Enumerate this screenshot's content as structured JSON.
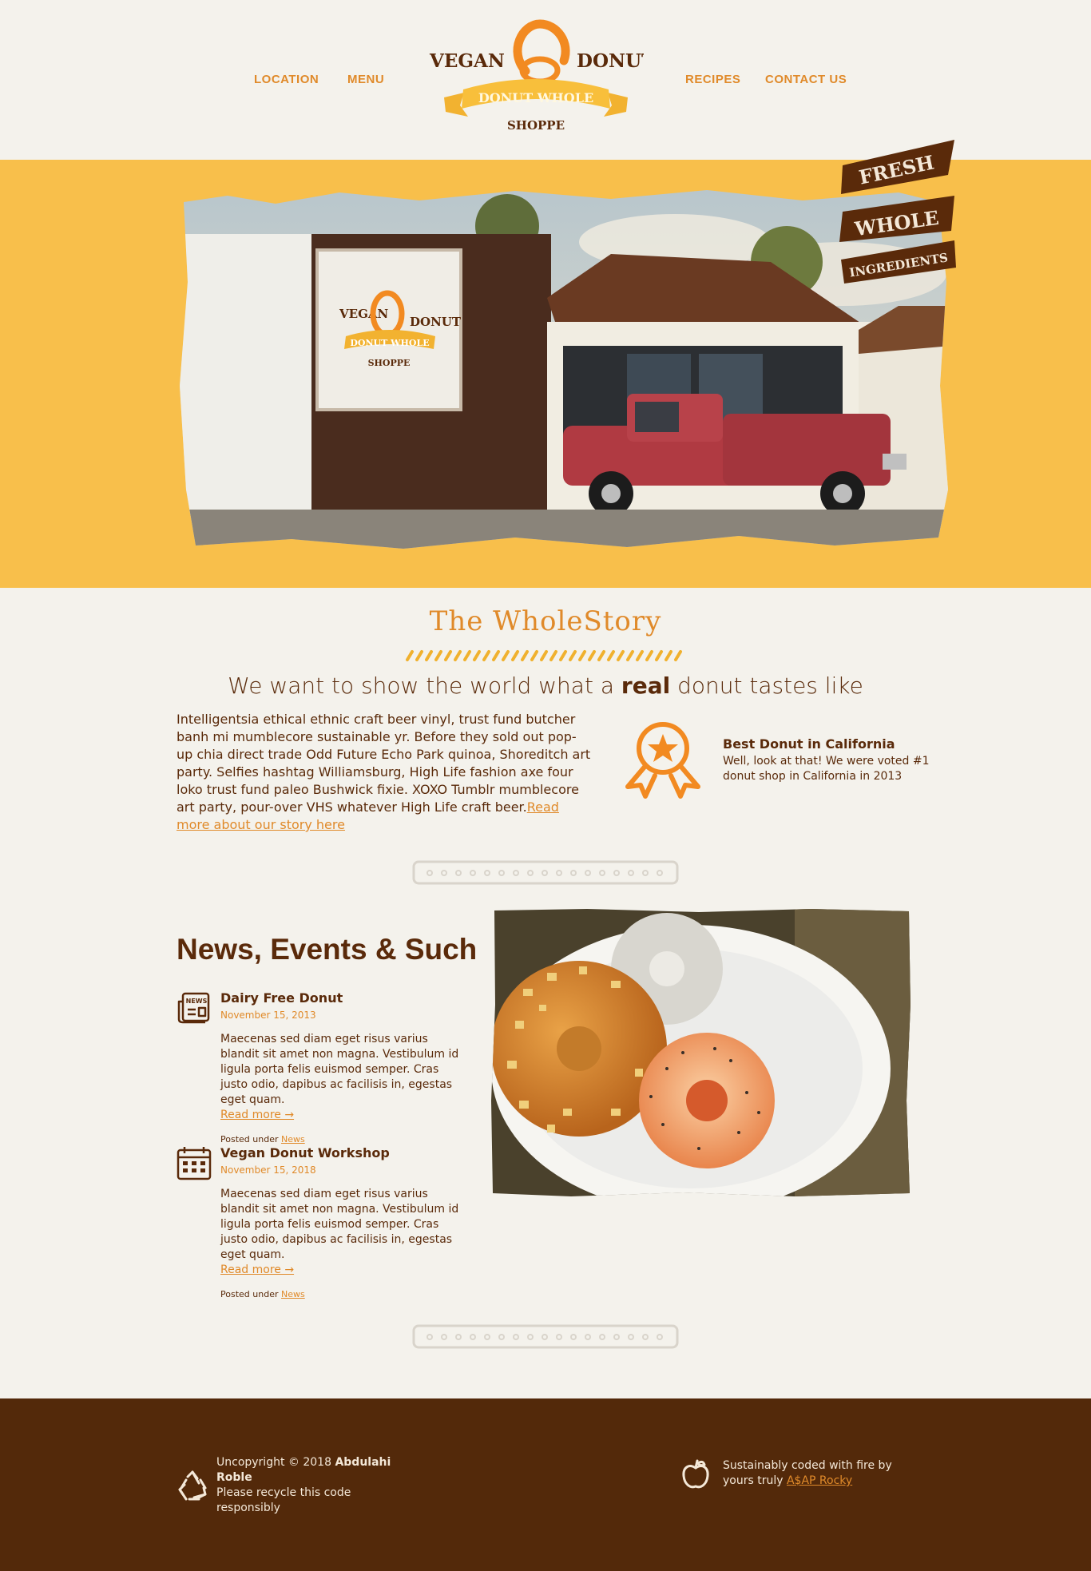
{
  "nav": {
    "location": "LOCATION",
    "menu": "MENU",
    "recipes": "RECIPES",
    "contact": "CONTACT US"
  },
  "logo": {
    "vegan": "VEGAN",
    "donut": "DONUT",
    "ribbon": "DONUT WHOLE",
    "shoppe": "SHOPPE"
  },
  "hero_badge": {
    "line1": "FRESH",
    "line2": "WHOLE",
    "line3": "INGREDIENTS"
  },
  "story": {
    "title_part1": "The ",
    "title_part2": "Whole",
    "title_part3": "Story",
    "tagline_pre": "We want to show the world what a ",
    "tagline_bold": "real",
    "tagline_post": " donut tastes like",
    "body": "Intelligentsia ethical ethnic craft beer vinyl, trust fund butcher banh mi mumblecore sustainable yr. Before they sold out pop-up chia direct trade Odd Future Echo Park quinoa, Shoreditch art party. Selfies hashtag Williamsburg, High Life fashion axe four loko trust fund paleo Bushwick fixie. XOXO Tumblr mumblecore art party, pour-over VHS whatever High Life craft beer.",
    "read_more": "Read more about our story here"
  },
  "award": {
    "title": "Best Donut in California",
    "text": "Well, look at that! We were voted #1 donut shop in California in 2013"
  },
  "news": {
    "heading": "News, Events & Such",
    "items": [
      {
        "title": "Dairy Free Donut",
        "date": "November 15, 2013",
        "body": "Maecenas sed diam eget risus varius blandit sit amet non magna. Vestibulum id ligula porta felis euismod semper. Cras justo odio, dapibus ac facilisis in, egestas eget quam.",
        "read_more": "Read more →",
        "posted_label": "Posted under ",
        "category": "News",
        "icon": "newspaper-icon"
      },
      {
        "title": "Vegan Donut Workshop",
        "date": "November 15, 2018",
        "body": "Maecenas sed diam eget risus varius blandit sit amet non magna. Vestibulum id ligula porta felis euismod semper. Cras justo odio, dapibus ac facilisis in, egestas eget quam.",
        "read_more": "Read more →",
        "posted_label": "Posted under ",
        "category": "News",
        "icon": "calendar-icon"
      }
    ]
  },
  "footer": {
    "copyright_pre": "Uncopyright © 2018 ",
    "author": "Abdulahi Roble",
    "recycle_note": "Please recycle this code responsibly",
    "credit_pre": "Sustainably coded with fire by yours truly ",
    "credit_name": "A$AP Rocky"
  },
  "colors": {
    "brand_orange": "#e08a2a",
    "brand_brown": "#5a2a0a",
    "hero_yellow": "#f8bf4b",
    "footer_brown": "#53290a",
    "page_bg": "#f4f2ec"
  }
}
